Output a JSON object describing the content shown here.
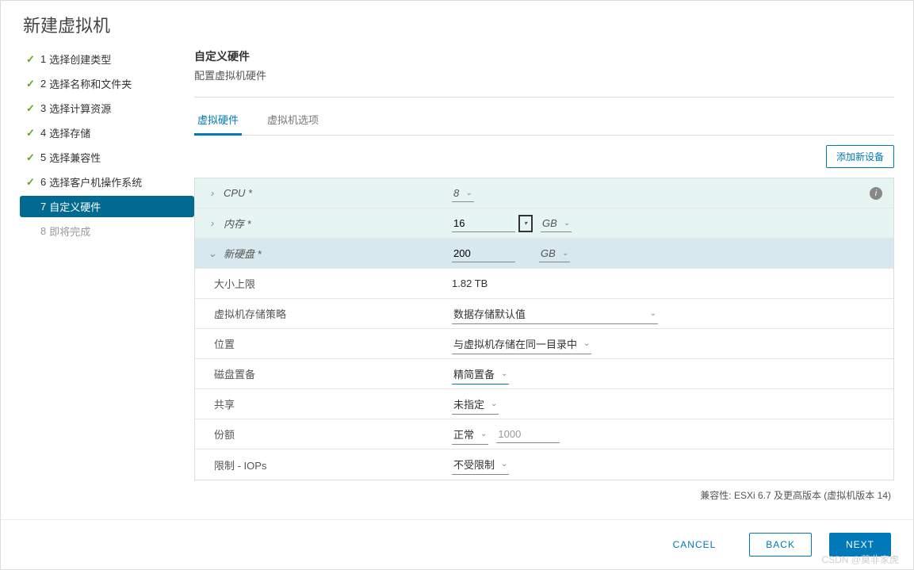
{
  "title": "新建虚拟机",
  "sidebar": {
    "steps": [
      {
        "num": "1",
        "label": "选择创建类型",
        "done": true
      },
      {
        "num": "2",
        "label": "选择名称和文件夹",
        "done": true
      },
      {
        "num": "3",
        "label": "选择计算资源",
        "done": true
      },
      {
        "num": "4",
        "label": "选择存储",
        "done": true
      },
      {
        "num": "5",
        "label": "选择兼容性",
        "done": true
      },
      {
        "num": "6",
        "label": "选择客户机操作系统",
        "done": true
      },
      {
        "num": "7",
        "label": "自定义硬件",
        "active": true
      },
      {
        "num": "8",
        "label": "即将完成",
        "future": true
      }
    ]
  },
  "section": {
    "title": "自定义硬件",
    "subtitle": "配置虚拟机硬件"
  },
  "tabs": {
    "hw": "虚拟硬件",
    "opts": "虚拟机选项"
  },
  "toolbar": {
    "add_device": "添加新设备"
  },
  "rows": {
    "cpu": {
      "label": "CPU *",
      "value": "8"
    },
    "mem": {
      "label": "内存 *",
      "value": "16",
      "unit": "GB"
    },
    "disk": {
      "label": "新硬盘 *",
      "value": "200",
      "unit": "GB"
    },
    "maxsize": {
      "label": "大小上限",
      "value": "1.82 TB"
    },
    "policy": {
      "label": "虚拟机存储策略",
      "value": "数据存储默认值"
    },
    "location": {
      "label": "位置",
      "value": "与虚拟机存储在同一目录中"
    },
    "provision": {
      "label": "磁盘置备",
      "value": "精简置备"
    },
    "sharing": {
      "label": "共享",
      "value": "未指定"
    },
    "shares": {
      "label": "份额",
      "value": "正常",
      "amount": "1000"
    },
    "limit": {
      "label": "限制 - IOPs",
      "value": "不受限制"
    }
  },
  "compat": "兼容性: ESXi 6.7 及更高版本 (虚拟机版本 14)",
  "footer": {
    "cancel": "CANCEL",
    "back": "BACK",
    "next": "NEXT"
  },
  "watermark": "CSDN @莫非家虎"
}
